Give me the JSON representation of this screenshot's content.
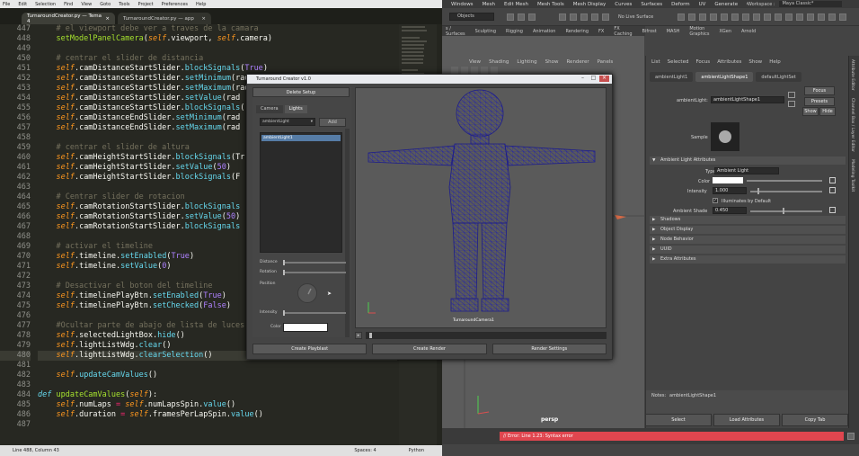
{
  "editor": {
    "menu": [
      "File",
      "Edit",
      "Selection",
      "Find",
      "View",
      "Goto",
      "Tools",
      "Project",
      "Preferences",
      "Help"
    ],
    "tabs": [
      {
        "label": "TurnaroundCreator.py — Tema 4",
        "active": true
      },
      {
        "label": "TurnaroundCreator.py — app",
        "active": false
      }
    ],
    "line_numbers": [
      "447",
      "448",
      "449",
      "450",
      "451",
      "452",
      "453",
      "454",
      "455",
      "456",
      "457",
      "458",
      "459",
      "460",
      "461",
      "462",
      "463",
      "464",
      "465",
      "466",
      "467",
      "468",
      "469",
      "470",
      "471",
      "472",
      "473",
      "474",
      "475",
      "476",
      "477",
      "478",
      "479",
      "480",
      "481",
      "482",
      "483",
      "484",
      "485",
      "486",
      "487"
    ],
    "lines": [
      [
        {
          "c": "c",
          "t": "    # el viewport debe ver a traves de la camara"
        }
      ],
      [
        {
          "c": "f",
          "t": "    setModelPanelCamera"
        },
        {
          "c": "",
          "t": "("
        },
        {
          "c": "i",
          "t": "self"
        },
        {
          "c": "",
          "t": ".viewport, "
        },
        {
          "c": "i",
          "t": "self"
        },
        {
          "c": "",
          "t": ".camera)"
        }
      ],
      [
        {
          "c": "",
          "t": ""
        }
      ],
      [
        {
          "c": "c",
          "t": "    # centrar el slider de distancia"
        }
      ],
      [
        {
          "c": "i",
          "t": "    self"
        },
        {
          "c": "",
          "t": ".camDistanceStartSlider."
        },
        {
          "c": "s",
          "t": "blockSignals"
        },
        {
          "c": "",
          "t": "("
        },
        {
          "c": "n",
          "t": "True"
        },
        {
          "c": "",
          "t": ")"
        }
      ],
      [
        {
          "c": "i",
          "t": "    self"
        },
        {
          "c": "",
          "t": ".camDistanceStartSlider."
        },
        {
          "c": "s",
          "t": "setMinimum"
        },
        {
          "c": "",
          "t": "(rad"
        }
      ],
      [
        {
          "c": "i",
          "t": "    self"
        },
        {
          "c": "",
          "t": ".camDistanceStartSlider."
        },
        {
          "c": "s",
          "t": "setMaximum"
        },
        {
          "c": "",
          "t": "(rad"
        }
      ],
      [
        {
          "c": "i",
          "t": "    self"
        },
        {
          "c": "",
          "t": ".camDistanceStartSlider."
        },
        {
          "c": "s",
          "t": "setValue"
        },
        {
          "c": "",
          "t": "(rad"
        }
      ],
      [
        {
          "c": "i",
          "t": "    self"
        },
        {
          "c": "",
          "t": ".camDistanceStartSlider."
        },
        {
          "c": "s",
          "t": "blockSignals"
        },
        {
          "c": "",
          "t": "("
        }
      ],
      [
        {
          "c": "i",
          "t": "    self"
        },
        {
          "c": "",
          "t": ".camDistanceEndSlider."
        },
        {
          "c": "s",
          "t": "setMinimum"
        },
        {
          "c": "",
          "t": "(rad"
        }
      ],
      [
        {
          "c": "i",
          "t": "    self"
        },
        {
          "c": "",
          "t": ".camDistanceEndSlider."
        },
        {
          "c": "s",
          "t": "setMaximum"
        },
        {
          "c": "",
          "t": "(rad"
        }
      ],
      [
        {
          "c": "",
          "t": ""
        }
      ],
      [
        {
          "c": "c",
          "t": "    # centrar el slider de altura"
        }
      ],
      [
        {
          "c": "i",
          "t": "    self"
        },
        {
          "c": "",
          "t": ".camHeightStartSlider."
        },
        {
          "c": "s",
          "t": "blockSignals"
        },
        {
          "c": "",
          "t": "(Tr"
        }
      ],
      [
        {
          "c": "i",
          "t": "    self"
        },
        {
          "c": "",
          "t": ".camHeightStartSlider."
        },
        {
          "c": "s",
          "t": "setValue"
        },
        {
          "c": "",
          "t": "("
        },
        {
          "c": "n",
          "t": "50"
        },
        {
          "c": "",
          "t": ")"
        }
      ],
      [
        {
          "c": "i",
          "t": "    self"
        },
        {
          "c": "",
          "t": ".camHeightStartSlider."
        },
        {
          "c": "s",
          "t": "blockSignals"
        },
        {
          "c": "",
          "t": "(F"
        }
      ],
      [
        {
          "c": "",
          "t": ""
        }
      ],
      [
        {
          "c": "c",
          "t": "    # Centrar slider de rotacion"
        }
      ],
      [
        {
          "c": "i",
          "t": "    self"
        },
        {
          "c": "",
          "t": ".camRotationStartSlider."
        },
        {
          "c": "s",
          "t": "blockSignals"
        }
      ],
      [
        {
          "c": "i",
          "t": "    self"
        },
        {
          "c": "",
          "t": ".camRotationStartSlider."
        },
        {
          "c": "s",
          "t": "setValue"
        },
        {
          "c": "",
          "t": "("
        },
        {
          "c": "n",
          "t": "50"
        },
        {
          "c": "",
          "t": ")"
        }
      ],
      [
        {
          "c": "i",
          "t": "    self"
        },
        {
          "c": "",
          "t": ".camRotationStartSlider."
        },
        {
          "c": "s",
          "t": "blockSignals"
        }
      ],
      [
        {
          "c": "",
          "t": ""
        }
      ],
      [
        {
          "c": "c",
          "t": "    # activar el timeline"
        }
      ],
      [
        {
          "c": "i",
          "t": "    self"
        },
        {
          "c": "",
          "t": ".timeline."
        },
        {
          "c": "s",
          "t": "setEnabled"
        },
        {
          "c": "",
          "t": "("
        },
        {
          "c": "n",
          "t": "True"
        },
        {
          "c": "",
          "t": ")"
        }
      ],
      [
        {
          "c": "i",
          "t": "    self"
        },
        {
          "c": "",
          "t": ".timeline."
        },
        {
          "c": "s",
          "t": "setValue"
        },
        {
          "c": "",
          "t": "("
        },
        {
          "c": "n",
          "t": "0"
        },
        {
          "c": "",
          "t": ")"
        }
      ],
      [
        {
          "c": "",
          "t": ""
        }
      ],
      [
        {
          "c": "c",
          "t": "    # Desactivar el boton del timeline"
        }
      ],
      [
        {
          "c": "i",
          "t": "    self"
        },
        {
          "c": "",
          "t": ".timelinePlayBtn."
        },
        {
          "c": "s",
          "t": "setEnabled"
        },
        {
          "c": "",
          "t": "("
        },
        {
          "c": "n",
          "t": "True"
        },
        {
          "c": "",
          "t": ")"
        }
      ],
      [
        {
          "c": "i",
          "t": "    self"
        },
        {
          "c": "",
          "t": ".timelinePlayBtn."
        },
        {
          "c": "s",
          "t": "setChecked"
        },
        {
          "c": "",
          "t": "("
        },
        {
          "c": "n",
          "t": "False"
        },
        {
          "c": "",
          "t": ")"
        }
      ],
      [
        {
          "c": "",
          "t": ""
        }
      ],
      [
        {
          "c": "c",
          "t": "    #Ocultar parte de abajo de lista de luces"
        }
      ],
      [
        {
          "c": "i",
          "t": "    self"
        },
        {
          "c": "",
          "t": ".selectedLightBox."
        },
        {
          "c": "s",
          "t": "hide"
        },
        {
          "c": "",
          "t": "()"
        }
      ],
      [
        {
          "c": "i",
          "t": "    self"
        },
        {
          "c": "",
          "t": ".lightListWdg."
        },
        {
          "c": "s",
          "t": "clear"
        },
        {
          "c": "",
          "t": "()"
        }
      ],
      [
        {
          "c": "i",
          "t": "    self"
        },
        {
          "c": "",
          "t": ".lightListWdg."
        },
        {
          "c": "s",
          "t": "clearSelection"
        },
        {
          "c": "",
          "t": "()"
        }
      ],
      [
        {
          "c": "",
          "t": ""
        }
      ],
      [
        {
          "c": "i",
          "t": "    self"
        },
        {
          "c": "",
          "t": "."
        },
        {
          "c": "s",
          "t": "updateCamValues"
        },
        {
          "c": "",
          "t": "()"
        }
      ],
      [
        {
          "c": "",
          "t": ""
        }
      ],
      [
        {
          "c": "d",
          "t": "def "
        },
        {
          "c": "f",
          "t": "updateCamValues"
        },
        {
          "c": "",
          "t": "("
        },
        {
          "c": "i",
          "t": "self"
        },
        {
          "c": "",
          "t": "):"
        }
      ],
      [
        {
          "c": "i",
          "t": "    self"
        },
        {
          "c": "",
          "t": ".numLaps "
        },
        {
          "c": "k",
          "t": "="
        },
        {
          "c": "i",
          "t": " self"
        },
        {
          "c": "",
          "t": ".numLapsSpin."
        },
        {
          "c": "s",
          "t": "value"
        },
        {
          "c": "",
          "t": "()"
        }
      ],
      [
        {
          "c": "i",
          "t": "    self"
        },
        {
          "c": "",
          "t": ".duration "
        },
        {
          "c": "k",
          "t": "="
        },
        {
          "c": "i",
          "t": " self"
        },
        {
          "c": "",
          "t": ".framesPerLapSpin."
        },
        {
          "c": "s",
          "t": "value"
        },
        {
          "c": "",
          "t": "()"
        }
      ],
      [
        {
          "c": "",
          "t": ""
        }
      ]
    ],
    "highlight_line": 33,
    "status": {
      "position": "Line 488, Column 43",
      "spaces": "Spaces: 4",
      "syntax": "Python"
    }
  },
  "maya": {
    "menu": [
      "Windows",
      "Mesh",
      "Edit Mesh",
      "Mesh Tools",
      "Mesh Display",
      "Curves",
      "Surfaces",
      "Deform",
      "UV",
      "Generate",
      "Cache"
    ],
    "workspace_label": "Workspace :",
    "workspace_value": "Maya Classic*",
    "objects_label": "Objects",
    "live_surface": "No Live Surface",
    "shelf_tabs": [
      "s / Surfaces",
      "Sculpting",
      "Rigging",
      "Animation",
      "Rendering",
      "FX",
      "FX Caching",
      "Bifrost",
      "MASH",
      "Motion Graphics",
      "XGen",
      "Arnold"
    ],
    "panel_menu": [
      "View",
      "Shading",
      "Lighting",
      "Show",
      "Renderer",
      "Panels"
    ],
    "camera_label": "persp",
    "error_text": "// Error: Line 1.23: Syntax error",
    "attribute_editor": {
      "menu": [
        "List",
        "Selected",
        "Focus",
        "Attributes",
        "Show",
        "Help"
      ],
      "tabs": [
        {
          "label": "ambientLight1",
          "active": false
        },
        {
          "label": "ambientLightShape1",
          "active": true
        },
        {
          "label": "defaultLightSet",
          "active": false
        }
      ],
      "node_label": "ambientLight:",
      "node_value": "ambientLightShape1",
      "focus_btn": "Focus",
      "presets_btn": "Presets",
      "show_btn": "Show",
      "hide_btn": "Hide",
      "sample_label": "Sample",
      "section_main": "Ambient Light Attributes",
      "type_label": "Type",
      "type_value": "Ambient Light",
      "color_label": "Color",
      "intensity_label": "Intensity",
      "intensity_value": "1.000",
      "intensity_level": 0.1,
      "illuminates_label": "Illuminates by Default",
      "ambient_shade_label": "Ambient Shade",
      "ambient_shade_value": "0.450",
      "ambient_shade_level": 0.45,
      "sections": [
        "Shadows",
        "Object Display",
        "Node Behavior",
        "UUID",
        "Extra Attributes"
      ],
      "notes_label": "Notes:",
      "notes_value": "ambientLightShape1",
      "buttons": [
        "Select",
        "Load Attributes",
        "Copy Tab"
      ]
    },
    "right_strip": [
      "Attribute Editor",
      "Channel Box / Layer Editor",
      "Modeling Toolkit"
    ]
  },
  "dialog": {
    "title": "Turnaround Creator v1.0",
    "delete_setup": "Delete Setup",
    "tabs": [
      {
        "label": "Camera",
        "active": false
      },
      {
        "label": "Lights",
        "active": true
      }
    ],
    "light_combo": "ambientLight",
    "add_btn": "Add",
    "light_items": [
      "ambientLight1"
    ],
    "distance_label": "Distance",
    "rotation_label": "Rotation",
    "position_label": "Position",
    "intensity_label": "Intensity",
    "color_label": "Color",
    "camera_label": "TurnaroundCamera1",
    "buttons": [
      "Create Playblast",
      "Create Render",
      "Render Settings"
    ]
  }
}
